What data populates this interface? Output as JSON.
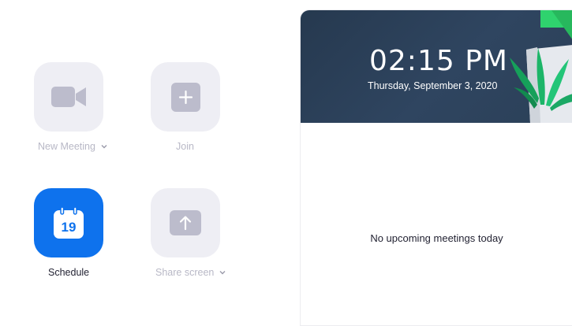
{
  "actions": {
    "new_meeting": {
      "label": "New Meeting"
    },
    "join": {
      "label": "Join"
    },
    "schedule": {
      "label": "Schedule",
      "calendar_day": "19"
    },
    "share_screen": {
      "label": "Share screen"
    }
  },
  "header": {
    "time": "02:15 PM",
    "date": "Thursday, September 3, 2020"
  },
  "meetings": {
    "empty_message": "No upcoming meetings today"
  },
  "colors": {
    "tile_bg": "#eeeef4",
    "icon_gray": "#bcbccc",
    "accent": "#0e72ed",
    "header_bg": "#2f4560"
  },
  "icons": [
    "video-camera-icon",
    "plus-icon",
    "calendar-icon",
    "share-arrow-icon",
    "chevron-down-icon"
  ]
}
